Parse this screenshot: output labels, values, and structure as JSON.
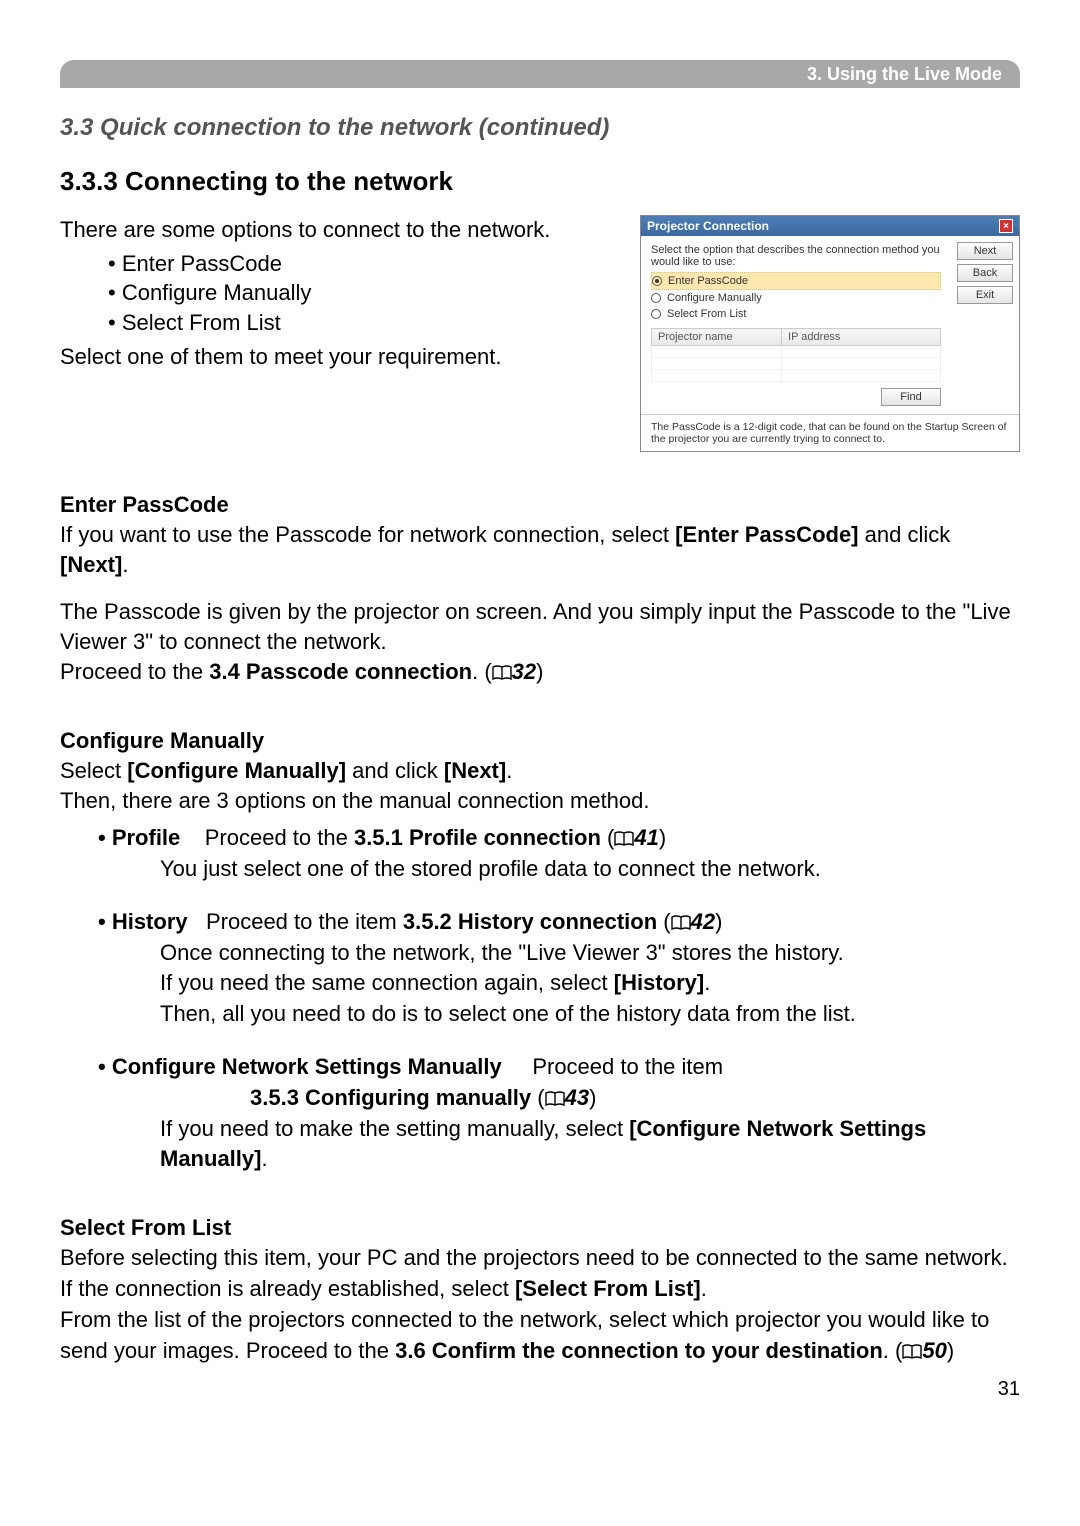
{
  "header": {
    "title": "3. Using the Live Mode"
  },
  "section_title": "3.3 Quick connection to the network (continued)",
  "subsection_title": "3.3.3 Connecting to the network",
  "intro_line": "There are some options to connect to the network.",
  "bullets": {
    "b1": "• Enter PassCode",
    "b2": "• Configure Manually",
    "b3": "• Select From List"
  },
  "select_line": "Select one of them to meet your requirement.",
  "dialog": {
    "title": "Projector Connection",
    "desc": "Select the option that describes the connection method you would like to use:",
    "opt1": "Enter PassCode",
    "opt2": "Configure Manually",
    "opt3": "Select From List",
    "col1": "Projector name",
    "col2": "IP address",
    "find": "Find",
    "btn_next": "Next",
    "btn_back": "Back",
    "btn_exit": "Exit",
    "footer": "The PassCode is a 12-digit code, that can be found on the Startup Screen of the projector you are currently trying to connect to."
  },
  "enter": {
    "heading": "Enter PassCode",
    "p1a": "If you want to use the Passcode for network connection, select ",
    "p1b": "[Enter PassCode]",
    "p1c": " and click ",
    "p1d": "[Next]",
    "p1e": ".",
    "p2": "The Passcode is given by the projector on screen. And you simply input the Passcode to the \"Live Viewer 3\" to connect the network.",
    "p3a": "Proceed to the ",
    "p3b": "3.4 Passcode connection",
    "p3c": ". (",
    "ref": "32",
    "p3d": ")"
  },
  "configure": {
    "heading": "Configure Manually",
    "l1a": "Select ",
    "l1b": "[Configure Manually]",
    "l1c": " and click ",
    "l1d": "[Next]",
    "l1e": ".",
    "l2": "Then, there are 3 options on the manual connection method.",
    "opt1": {
      "name": "• Profile",
      "proceed": "Proceed to the ",
      "ref_label": "3.5.1 Profile connection",
      "open": " (",
      "ref": "41",
      "close": ")",
      "desc": "You just select one of the stored profile data to connect the network."
    },
    "opt2": {
      "name": "• History",
      "proceed": "Proceed to the item ",
      "ref_label": "3.5.2 History connection",
      "open": " (",
      "ref": "42",
      "close": ")",
      "d1": "Once connecting to the network, the \"Live Viewer 3\" stores the history.",
      "d2a": "If you need the same connection again, select ",
      "d2b": "[History]",
      "d2c": ".",
      "d3": "Then, all you need to do is to select one of the history data from the list."
    },
    "opt3": {
      "name": "• Configure Network Settings Manually",
      "proceed": "Proceed to the item",
      "ref_label": "3.5.3 Configuring manually",
      "open": " (",
      "ref": "43",
      "close": ")",
      "d1a": "If you need to make the setting manually, select ",
      "d1b": "[Configure Network Settings Manually]",
      "d1c": "."
    }
  },
  "selectlist": {
    "heading": "Select From List",
    "p1": "Before selecting this item, your PC and the projectors need to be connected to the same network.",
    "p2a": "If the connection is already established, select ",
    "p2b": "[Select From List]",
    "p2c": ".",
    "p3a": "From the list of the projectors connected to the network, select which projector you would like to send your images. Proceed to the  ",
    "p3b": "3.6 Confirm the connection to your destination",
    "p3c": ". (",
    "ref": "50",
    "p3d": ")"
  },
  "page_number": "31"
}
